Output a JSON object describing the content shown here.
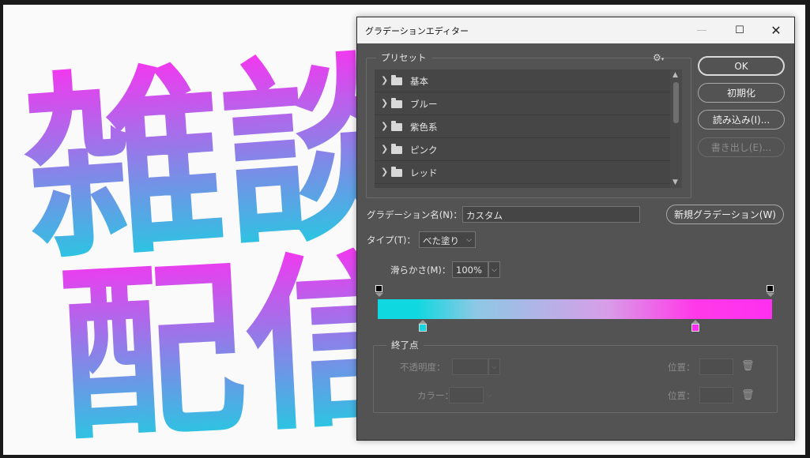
{
  "background": {
    "text_row1": "雑談",
    "text_row2": "配信",
    "gradient_colors": [
      "#ff2ff0",
      "#10d8e0"
    ]
  },
  "dialog": {
    "title": "グラデーションエディター",
    "window_controls": {
      "minimize": "—",
      "maximize": "☐",
      "close": "✕"
    },
    "presets": {
      "legend": "プリセット",
      "gear_icon": "⚙",
      "items": [
        {
          "label": "基本"
        },
        {
          "label": "ブルー"
        },
        {
          "label": "紫色系"
        },
        {
          "label": "ピンク"
        },
        {
          "label": "レッド"
        }
      ]
    },
    "buttons": {
      "ok": "OK",
      "reset": "初期化",
      "load": "読み込み(I)...",
      "save": "書き出し(E)...",
      "new_gradient": "新規グラデーション(W)"
    },
    "name_label": "グラデーション名(N)：",
    "name_value": "カスタム",
    "type_label": "タイプ(T)：",
    "type_value": "べた塗り",
    "smoothness_label": "滑らかさ(M)：",
    "smoothness_value": "100%",
    "gradient": {
      "opacity_stops": [
        {
          "position": 0,
          "color": "#000000"
        },
        {
          "position": 100,
          "color": "#000000"
        }
      ],
      "color_stops": [
        {
          "position": 12,
          "color": "#10d8e0"
        },
        {
          "position": 81,
          "color": "#ff2ff0"
        }
      ]
    },
    "stops": {
      "legend": "終了点",
      "opacity_label": "不透明度：",
      "opacity_position_label": "位置：",
      "color_label": "カラー：",
      "color_position_label": "位置："
    }
  }
}
